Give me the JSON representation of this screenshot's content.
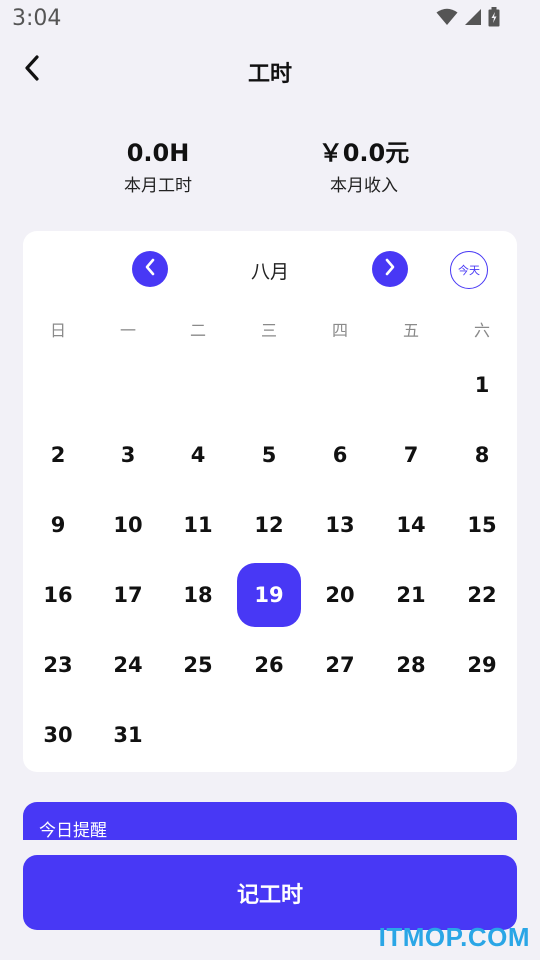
{
  "status_bar": {
    "time": "3:04",
    "icons": [
      "wifi-icon",
      "signal-icon",
      "battery-icon"
    ]
  },
  "nav": {
    "back_icon": "chevron-left-icon",
    "title": "工时"
  },
  "summary": {
    "hours_value": "0.0H",
    "hours_label": "本月工时",
    "income_value": "￥0.0元",
    "income_label": "本月收入"
  },
  "calendar": {
    "month": "八月",
    "today_label": "今天",
    "weekdays": [
      "日",
      "一",
      "二",
      "三",
      "四",
      "五",
      "六"
    ],
    "first_weekday_index": 6,
    "days_in_month": 31,
    "selected_day": 19
  },
  "reminder": {
    "title": "今日提醒"
  },
  "record_button": {
    "label": "记工时"
  },
  "watermark": "ITMOP.COM",
  "colors": {
    "accent": "#4838f5",
    "background": "#f2f1f7",
    "card": "#ffffff",
    "watermark": "#2aa6e6"
  }
}
